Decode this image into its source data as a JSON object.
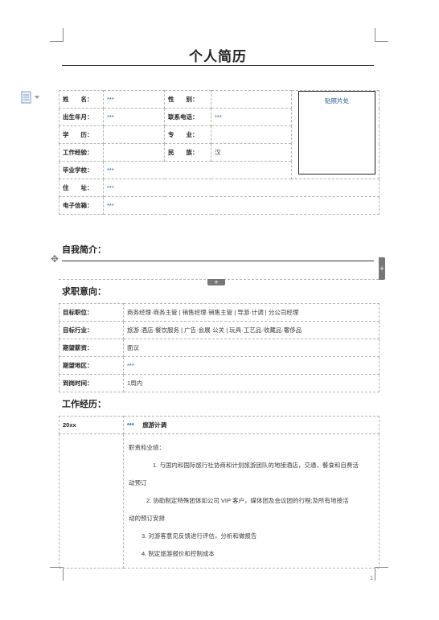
{
  "title": "个人简历",
  "info": {
    "name_label": "姓　　名：",
    "name_value": "***",
    "gender_label": "性　　别：",
    "gender_value": "",
    "birth_label": "出生年月：",
    "birth_value": "***",
    "phone_label": "联系电话：",
    "phone_value": "***",
    "edu_label": "学　　历：",
    "edu_value": "",
    "major_label": "专　　业：",
    "major_value": "",
    "exp_label": "工作经验：",
    "exp_value": "",
    "ethnic_label": "民　　族：",
    "ethnic_value": "汉",
    "school_label": "毕业学校：",
    "school_value": "***",
    "address_label": "住　　址：",
    "address_value": "***",
    "email_label": "电子信箱：",
    "email_value": "***",
    "photo_label": "贴照片处"
  },
  "self_intro": {
    "heading": "自我简介："
  },
  "job_intent": {
    "heading": "求职意向：",
    "rows": [
      {
        "label": "目标职位：",
        "value": "商务经理·商务主管 | 销售经理·销售主管 | 导游·计调 | 分公司经理"
      },
      {
        "label": "目标行业：",
        "value": "旅游·酒店·餐饮服务 | 广告·会展·公关 | 玩具·工艺品·收藏品·奢侈品"
      },
      {
        "label": "期望薪资：",
        "value": "面议"
      },
      {
        "label": "期望地区：",
        "value": "***"
      },
      {
        "label": "到岗时间：",
        "value": "1周内"
      }
    ]
  },
  "work": {
    "heading": "工作经历：",
    "period": "20xx",
    "company": "***",
    "position": "旅游计调",
    "lines": [
      "职责和业绩：",
      "1. 与国内和国际旅行社协商和计划旅游团队的地接酒店，交通，餐食和自费活",
      "动预订",
      "2. 协助制定特殊团体如公司 VIP 客户，媒体团及会议团的行程;及所有地接活",
      "动的预订安排",
      "3. 对游客意见反馈进行评估，分析和做报告",
      "4. 制定旅游报价和控制成本"
    ]
  },
  "page_number": "1"
}
